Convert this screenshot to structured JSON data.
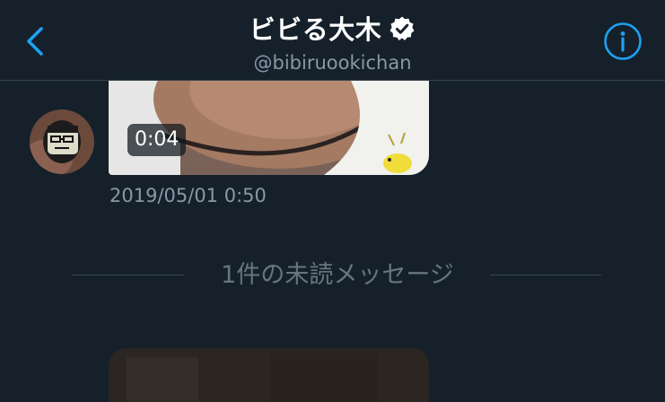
{
  "header": {
    "title": "ビビる大木",
    "handle": "@bibiruookichan",
    "back_icon": "chevron-left-icon",
    "info_icon": "info-icon",
    "verified_icon": "verified-badge-icon",
    "accent_color": "#1da1f2"
  },
  "messages": [
    {
      "type": "video",
      "duration": "0:04",
      "timestamp": "2019/05/01 0:50"
    },
    {
      "type": "image"
    }
  ],
  "unread_divider": {
    "label": "1件の未読メッセージ"
  },
  "colors": {
    "background": "#15202b",
    "separator": "#38444d",
    "secondary_text": "#8899a6"
  }
}
